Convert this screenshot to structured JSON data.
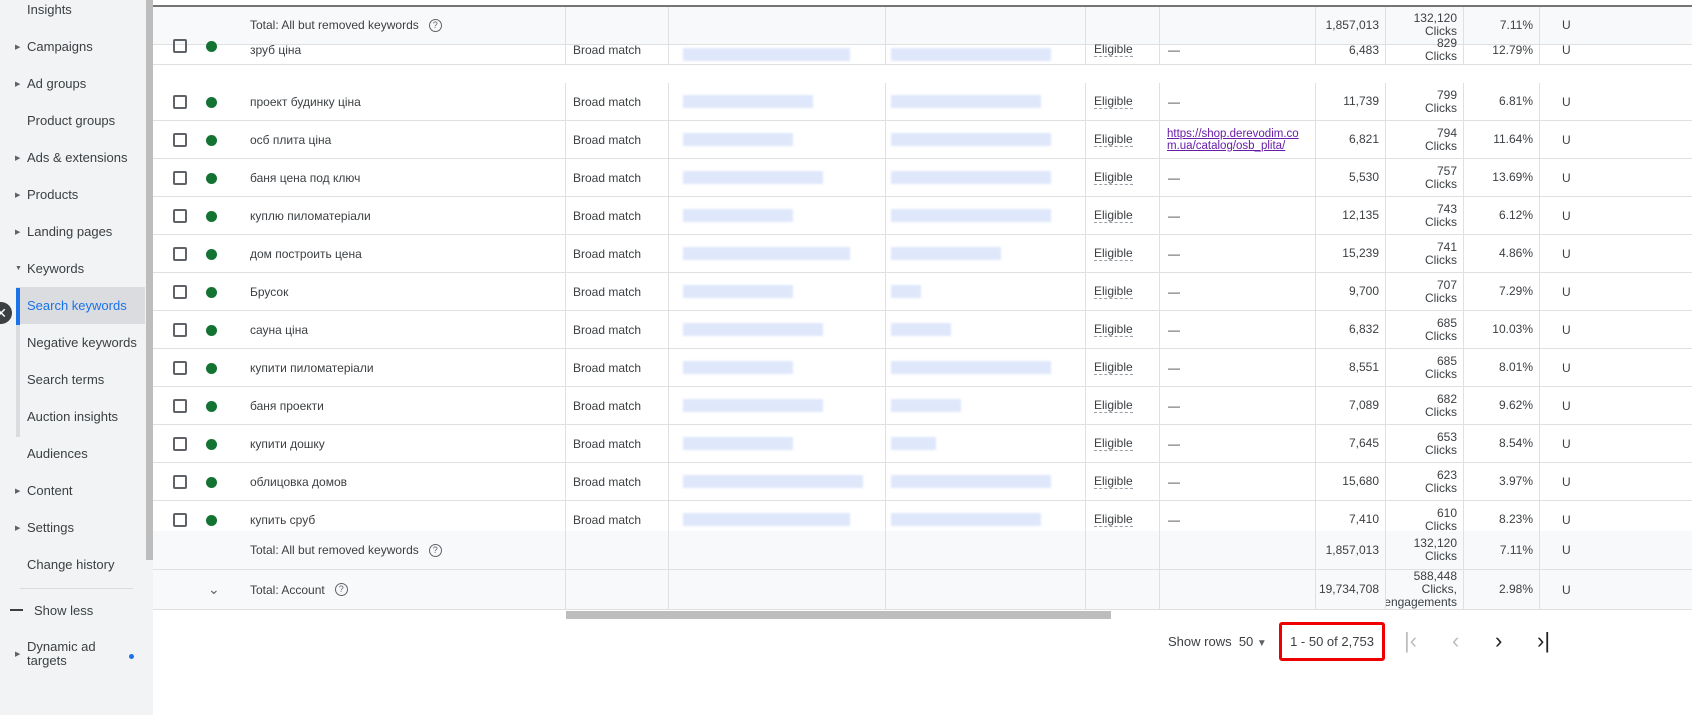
{
  "sidebar": {
    "items": [
      {
        "label": "Insights",
        "caret": false
      },
      {
        "label": "Campaigns",
        "caret": true
      },
      {
        "label": "Ad groups",
        "caret": true
      },
      {
        "label": "Product groups",
        "caret": false
      },
      {
        "label": "Ads & extensions",
        "caret": true
      },
      {
        "label": "Products",
        "caret": true
      },
      {
        "label": "Landing pages",
        "caret": true
      },
      {
        "label": "Keywords",
        "caret": true,
        "expanded": true
      },
      {
        "label": "Search keywords",
        "sub": true,
        "active": true
      },
      {
        "label": "Negative keywords",
        "sub": true
      },
      {
        "label": "Search terms",
        "sub": true
      },
      {
        "label": "Auction insights",
        "sub": true
      },
      {
        "label": "Audiences",
        "caret": false
      },
      {
        "label": "Content",
        "caret": true
      },
      {
        "label": "Settings",
        "caret": true
      },
      {
        "label": "Change history",
        "caret": false
      }
    ],
    "show_less": "Show less",
    "dynamic": "Dynamic ad targets"
  },
  "top_total": {
    "label": "Total: All but removed keywords",
    "impr": "1,857,013",
    "clicks": "132,120",
    "clicks_unit": "Clicks",
    "ctr": "7.11%",
    "extra": "U"
  },
  "rows": [
    {
      "keyword": "зруб ціна",
      "match": "Broad match",
      "status": "Eligible",
      "url": "—",
      "impr": "6,483",
      "clicks": "829",
      "unit": "Clicks",
      "ctr": "12.79%",
      "extra": "U"
    },
    {
      "keyword": "проект будинку ціна",
      "match": "Broad match",
      "status": "Eligible",
      "url": "—",
      "impr": "11,739",
      "clicks": "799",
      "unit": "Clicks",
      "ctr": "6.81%",
      "extra": "U"
    },
    {
      "keyword": "осб плита ціна",
      "match": "Broad match",
      "status": "Eligible",
      "url": "https://shop.derevodim.com.ua/catalog/osb_plita/",
      "impr": "6,821",
      "clicks": "794",
      "unit": "Clicks",
      "ctr": "11.64%",
      "extra": "U"
    },
    {
      "keyword": "баня цена под ключ",
      "match": "Broad match",
      "status": "Eligible",
      "url": "—",
      "impr": "5,530",
      "clicks": "757",
      "unit": "Clicks",
      "ctr": "13.69%",
      "extra": "U"
    },
    {
      "keyword": "куплю пиломатеріали",
      "match": "Broad match",
      "status": "Eligible",
      "url": "—",
      "impr": "12,135",
      "clicks": "743",
      "unit": "Clicks",
      "ctr": "6.12%",
      "extra": "U"
    },
    {
      "keyword": "дом построить цена",
      "match": "Broad match",
      "status": "Eligible",
      "url": "—",
      "impr": "15,239",
      "clicks": "741",
      "unit": "Clicks",
      "ctr": "4.86%",
      "extra": "U"
    },
    {
      "keyword": "Брусок",
      "match": "Broad match",
      "status": "Eligible",
      "url": "—",
      "impr": "9,700",
      "clicks": "707",
      "unit": "Clicks",
      "ctr": "7.29%",
      "extra": "U"
    },
    {
      "keyword": "сауна ціна",
      "match": "Broad match",
      "status": "Eligible",
      "url": "—",
      "impr": "6,832",
      "clicks": "685",
      "unit": "Clicks",
      "ctr": "10.03%",
      "extra": "U"
    },
    {
      "keyword": "купити пиломатеріали",
      "match": "Broad match",
      "status": "Eligible",
      "url": "—",
      "impr": "8,551",
      "clicks": "685",
      "unit": "Clicks",
      "ctr": "8.01%",
      "extra": "U"
    },
    {
      "keyword": "баня проекти",
      "match": "Broad match",
      "status": "Eligible",
      "url": "—",
      "impr": "7,089",
      "clicks": "682",
      "unit": "Clicks",
      "ctr": "9.62%",
      "extra": "U"
    },
    {
      "keyword": "купити дошку",
      "match": "Broad match",
      "status": "Eligible",
      "url": "—",
      "impr": "7,645",
      "clicks": "653",
      "unit": "Clicks",
      "ctr": "8.54%",
      "extra": "U"
    },
    {
      "keyword": "облицовка домов",
      "match": "Broad match",
      "status": "Eligible",
      "url": "—",
      "impr": "15,680",
      "clicks": "623",
      "unit": "Clicks",
      "ctr": "3.97%",
      "extra": "U"
    },
    {
      "keyword": "купить сруб",
      "match": "Broad match",
      "status": "Eligible",
      "url": "—",
      "impr": "7,410",
      "clicks": "610",
      "unit": "Clicks",
      "ctr": "8.23%",
      "extra": "U"
    }
  ],
  "bottom_total": {
    "label": "Total: All but removed keywords",
    "impr": "1,857,013",
    "clicks": "132,120",
    "clicks_unit": "Clicks",
    "ctr": "7.11%",
    "extra": "U"
  },
  "account_total": {
    "label": "Total: Account",
    "impr": "19,734,708",
    "clicks": "588,448",
    "clicks_unit": "Clicks, engagements",
    "ctr": "2.98%",
    "extra": "U"
  },
  "pager": {
    "show_rows_label": "Show rows",
    "rows_value": "50",
    "range": "1 - 50 of 2,753"
  },
  "colors": {
    "accent": "#1a73e8",
    "status_dot": "#137333",
    "highlight": "#ee0000",
    "link": "#681da8"
  }
}
